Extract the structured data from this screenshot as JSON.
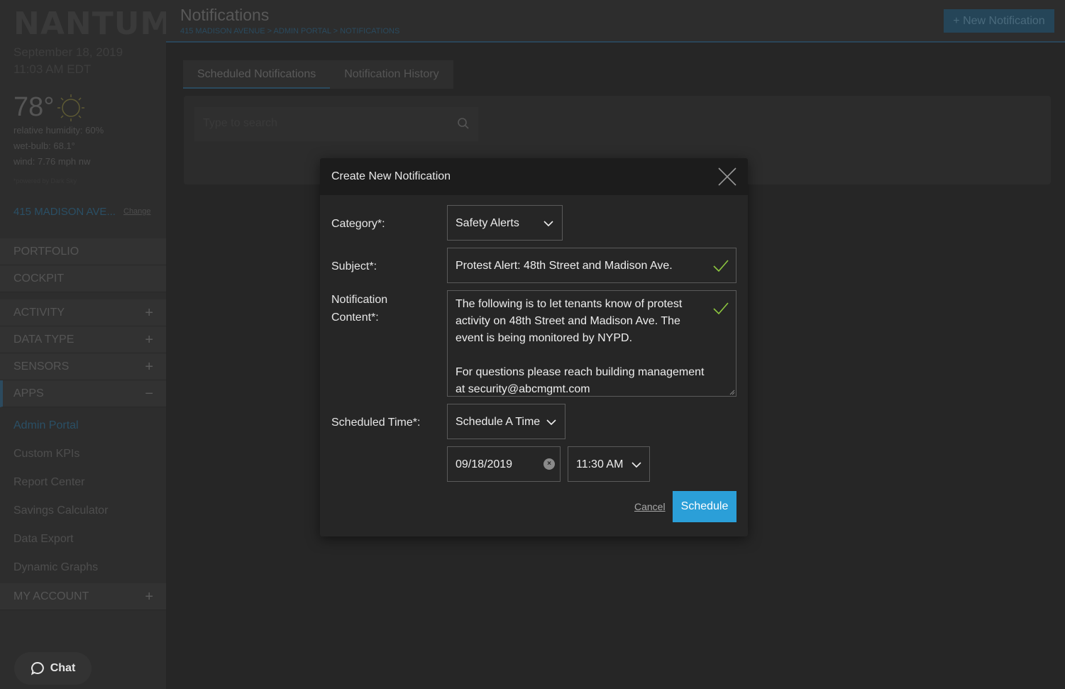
{
  "sidebar": {
    "logo": "NANTUM",
    "date": "September 18, 2019",
    "time": "11:03 AM EDT",
    "temperature": "78°",
    "weather_icon": "sun-icon",
    "humidity": "relative humidity: 60%",
    "wet_bulb": "wet-bulb: 68.1°",
    "wind": "wind: 7.76 mph nw",
    "powered_by": "*powered by Dark Sky",
    "building": "415 MADISON AVE...",
    "change_label": "Change",
    "nav_top": [
      "PORTFOLIO",
      "COCKPIT"
    ],
    "nav_sections": [
      {
        "label": "ACTIVITY",
        "toggle": "+"
      },
      {
        "label": "DATA TYPE",
        "toggle": "+"
      },
      {
        "label": "SENSORS",
        "toggle": "+"
      },
      {
        "label": "APPS",
        "toggle": "−"
      }
    ],
    "apps": [
      "Admin Portal",
      "Custom KPIs",
      "Report Center",
      "Savings Calculator",
      "Data Export",
      "Dynamic Graphs"
    ],
    "my_account": {
      "label": "MY ACCOUNT",
      "toggle": "+"
    },
    "chat_label": "Chat"
  },
  "header": {
    "title": "Notifications",
    "breadcrumb": "415 MADISON AVENUE > ADMIN PORTAL > NOTIFICATIONS",
    "new_button": "+ New Notification"
  },
  "tabs": [
    "Scheduled Notifications",
    "Notification History"
  ],
  "search": {
    "placeholder": "Type to search"
  },
  "modal": {
    "title": "Create New Notification",
    "category_label": "Category*:",
    "category_value": "Safety Alerts",
    "subject_label": "Subject*:",
    "subject_value": "Protest Alert: 48th Street and Madison Ave.",
    "content_label_1": "Notification",
    "content_label_2": "Content*:",
    "content_value": "The following is to let tenants know of protest\nactivity on 48th Street and Madison Ave. The\nevent is being monitored by NYPD.\n\nFor questions please reach building management\nat security@abcmgmt.com",
    "scheduled_label": "Scheduled Time*:",
    "scheduled_value": "Schedule A Time",
    "date_value": "09/18/2019",
    "time_value": "11:30 AM",
    "cancel_label": "Cancel",
    "schedule_label": "Schedule",
    "colors": {
      "accent": "#2b9fd8",
      "valid": "#8dc63f"
    }
  }
}
